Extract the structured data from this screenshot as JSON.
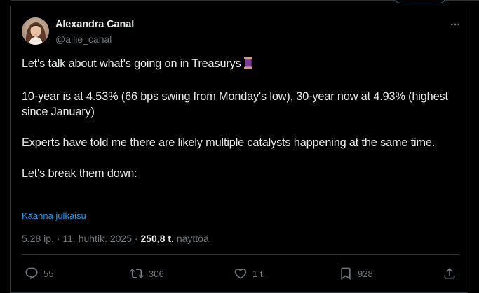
{
  "author": {
    "name": "Alexandra Canal",
    "handle": "@allie_canal"
  },
  "post": {
    "paragraphs": [
      "Let's talk about what's going on in Treasurys",
      "10-year is at 4.53% (66 bps swing from Monday's low), 30-year now at 4.93% (highest since January)",
      "Experts have told me there are likely multiple catalysts happening at the same time.",
      "Let's break them down:"
    ],
    "emoji": "spool-of-thread-icon",
    "translate_label": "Käännä julkaisu"
  },
  "meta": {
    "time": "5.28 ip.",
    "separator": "·",
    "date": "11. huhtik. 2025",
    "views_count": "250,8 t.",
    "views_label": "näyttöä"
  },
  "actions": {
    "replies": "55",
    "reposts": "306",
    "likes": "1 t.",
    "bookmarks": "928"
  },
  "colors": {
    "background": "#000000",
    "text": "#e7e9ea",
    "muted": "#71767b",
    "link": "#1d9bf0",
    "border": "#2f3336"
  }
}
